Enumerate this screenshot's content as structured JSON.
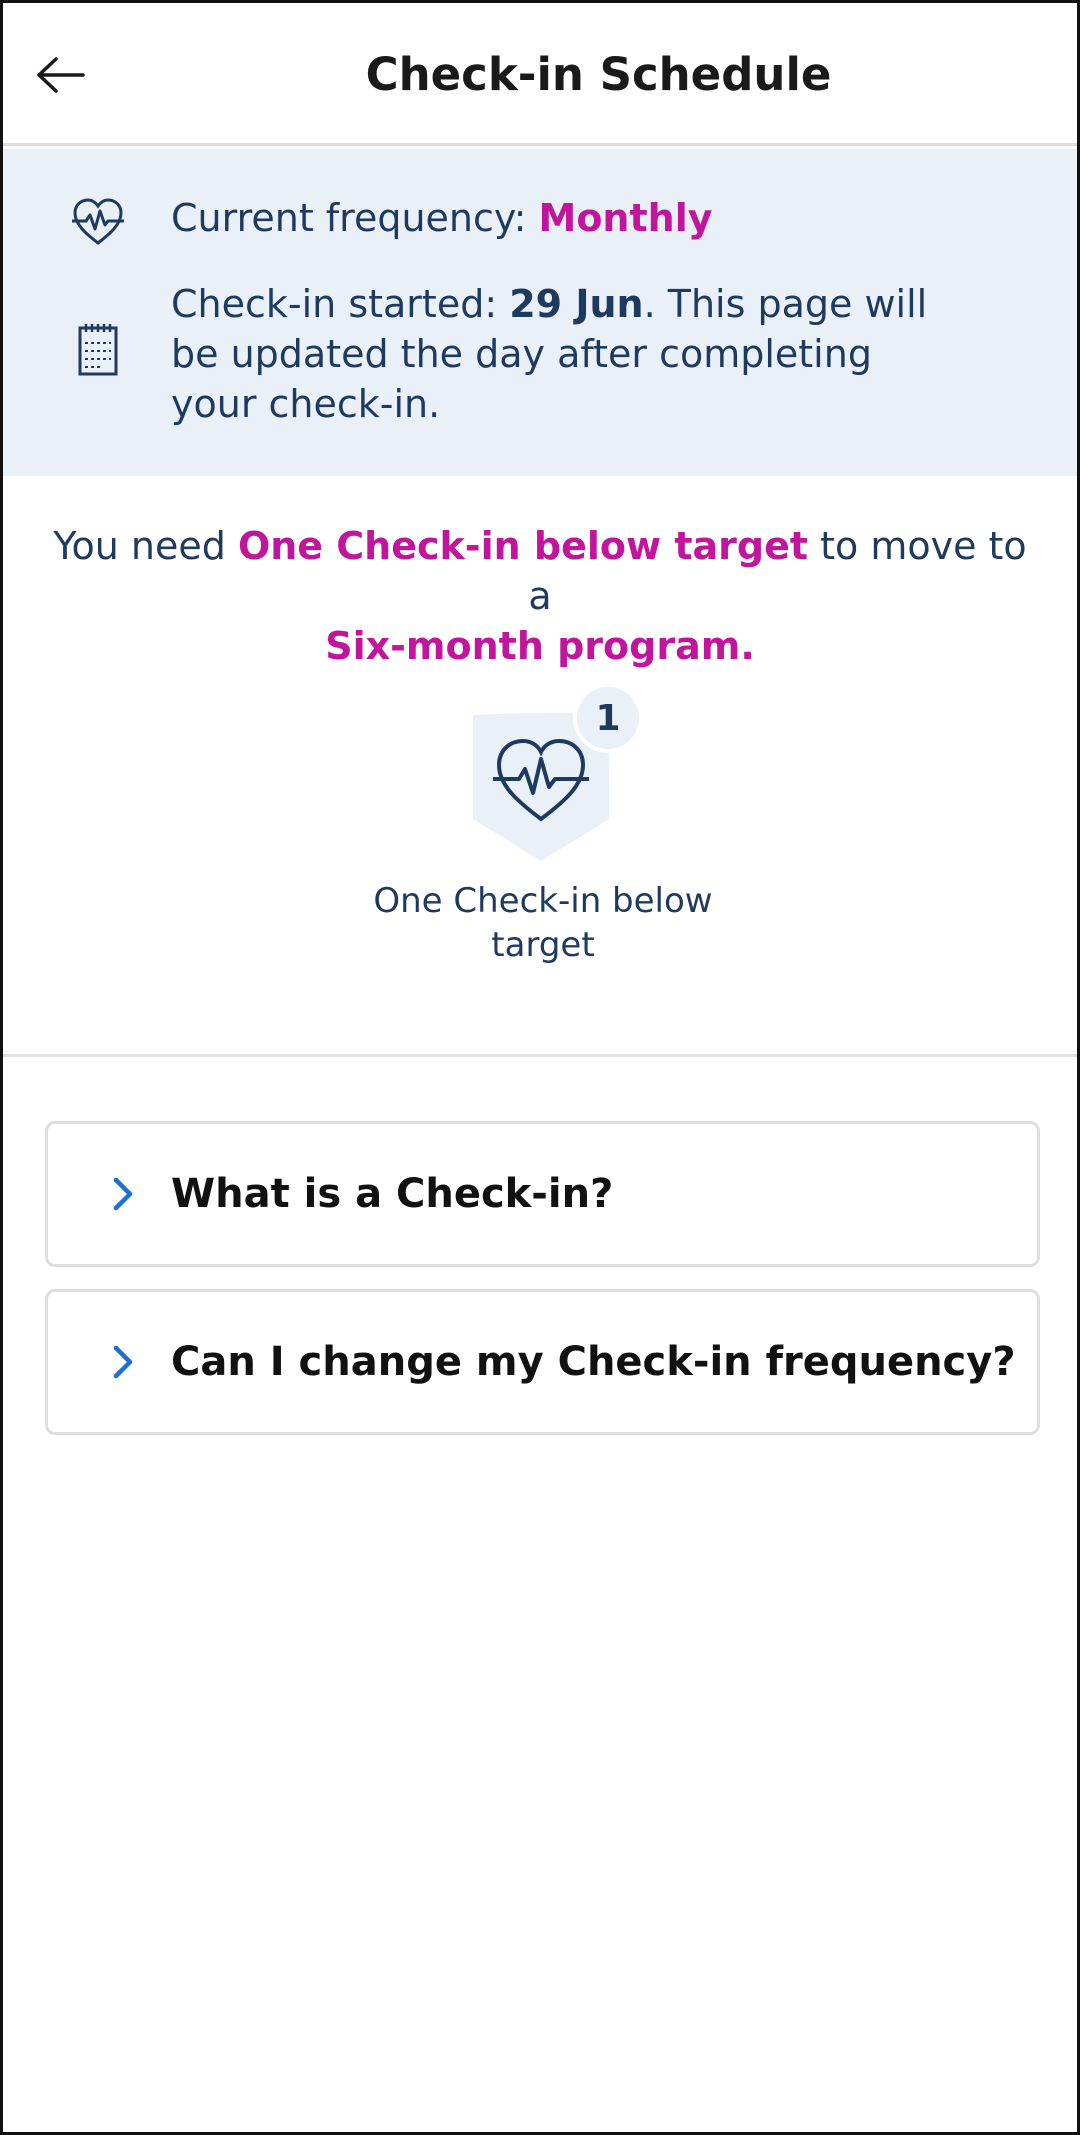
{
  "header": {
    "title": "Check-in Schedule",
    "back_icon": "arrow-left-icon"
  },
  "info": {
    "frequency_label": "Current frequency: ",
    "frequency_value": "Monthly",
    "frequency_icon": "heart-pulse-icon",
    "started_label": "Check-in started: ",
    "started_date": "29 Jun",
    "started_suffix": ". This page will be updated the day after completing your check-in.",
    "started_icon": "calendar-icon"
  },
  "target": {
    "prefix": "You need ",
    "highlight": "One Check-in below target",
    "middle": " to move to a ",
    "program": "Six-month program."
  },
  "badge": {
    "count": "1",
    "icon": "heart-pulse-icon",
    "label": "One Check-in below target"
  },
  "faq": [
    {
      "label": "What is a Check-in?",
      "icon": "chevron-right-icon"
    },
    {
      "label": "Can I change my Check-in frequency?",
      "icon": "chevron-right-icon"
    }
  ],
  "colors": {
    "accent": "#c0159c",
    "text": "#1e3a5f",
    "panel": "#e9f0f8",
    "chevron": "#1d6fd6"
  }
}
